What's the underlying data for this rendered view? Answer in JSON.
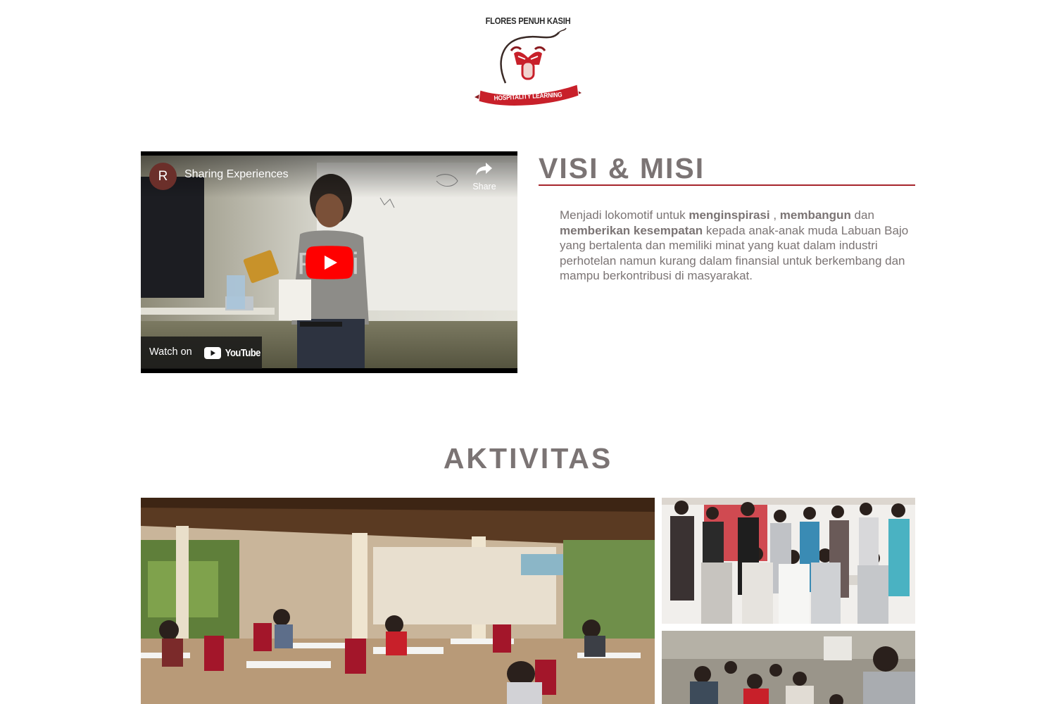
{
  "logo": {
    "title": "FLORES PENUH KASIH",
    "ribbon_text": "HOSPITALITY LEARNING",
    "colors": {
      "red": "#c8202a",
      "dark": "#2b2b2b"
    }
  },
  "video": {
    "channel_initial": "R",
    "title": "Sharing Experiences",
    "share_label": "Share",
    "watch_on_label": "Watch on",
    "youtube_wordmark": "YouTube",
    "icons": [
      "share-icon",
      "play-icon",
      "youtube-logo-icon"
    ]
  },
  "visi_misi": {
    "heading": "VISI & MISI",
    "text_1": "Menjadi lokomotif untuk ",
    "bold_1": "menginspirasi",
    "text_2": " , ",
    "bold_2": "membangun",
    "text_3": " dan ",
    "bold_3": "memberikan kesempatan",
    "text_4": " kepada anak-anak muda Labuan Bajo yang bertalenta dan memiliki minat yang kuat dalam industri perhotelan namun kurang dalam finansial untuk berkembang dan mampu berkontribusi di masyarakat.",
    "accent_color": "#a6252c"
  },
  "aktivitas": {
    "heading": "AKTIVITAS"
  },
  "colors": {
    "text": "#7b7474",
    "accent": "#a6252c",
    "youtube_red": "#ff0000"
  }
}
